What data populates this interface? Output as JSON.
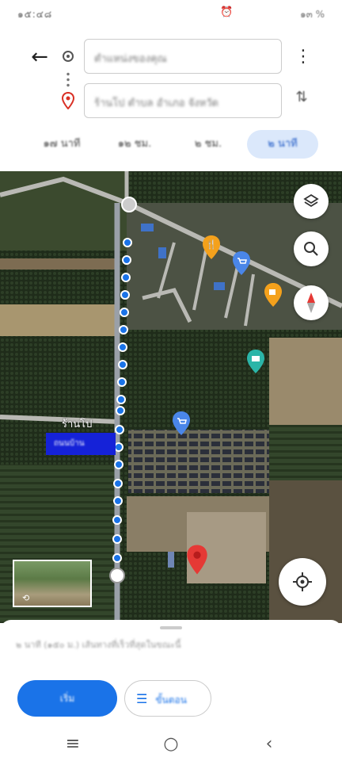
{
  "status_bar": {
    "time": "๑๕:๔๘",
    "alarm_icon": "alarm-icon",
    "right": "๑๓ %"
  },
  "search": {
    "origin_value": "ตำแหน่งของคุณ",
    "destination_value": "ร้านโป ตำบล อำเภอ จังหวัด"
  },
  "modes": [
    {
      "label": "๑๗ นาที",
      "icon": "car-icon"
    },
    {
      "label": "๑๒ ชม.",
      "icon": "transit-icon"
    },
    {
      "label": "๒ ชม.",
      "icon": "walk-icon"
    },
    {
      "label": "๒ นาที",
      "icon": "bike-icon"
    }
  ],
  "map": {
    "street_label": "ร้านโป",
    "highlighted_label": "ถนนบ้าน",
    "accent_color": "#1a73e8",
    "destination_pin_color": "#e53935"
  },
  "sheet": {
    "summary": "๒ นาที (๑๕๐ ม.) เส้นทางที่เร็วที่สุดในขณะนี้",
    "start_label": "เริ่ม",
    "steps_label": "ขั้นตอน"
  },
  "navbar": {
    "menu": "≡",
    "home": "○",
    "back": "‹"
  }
}
